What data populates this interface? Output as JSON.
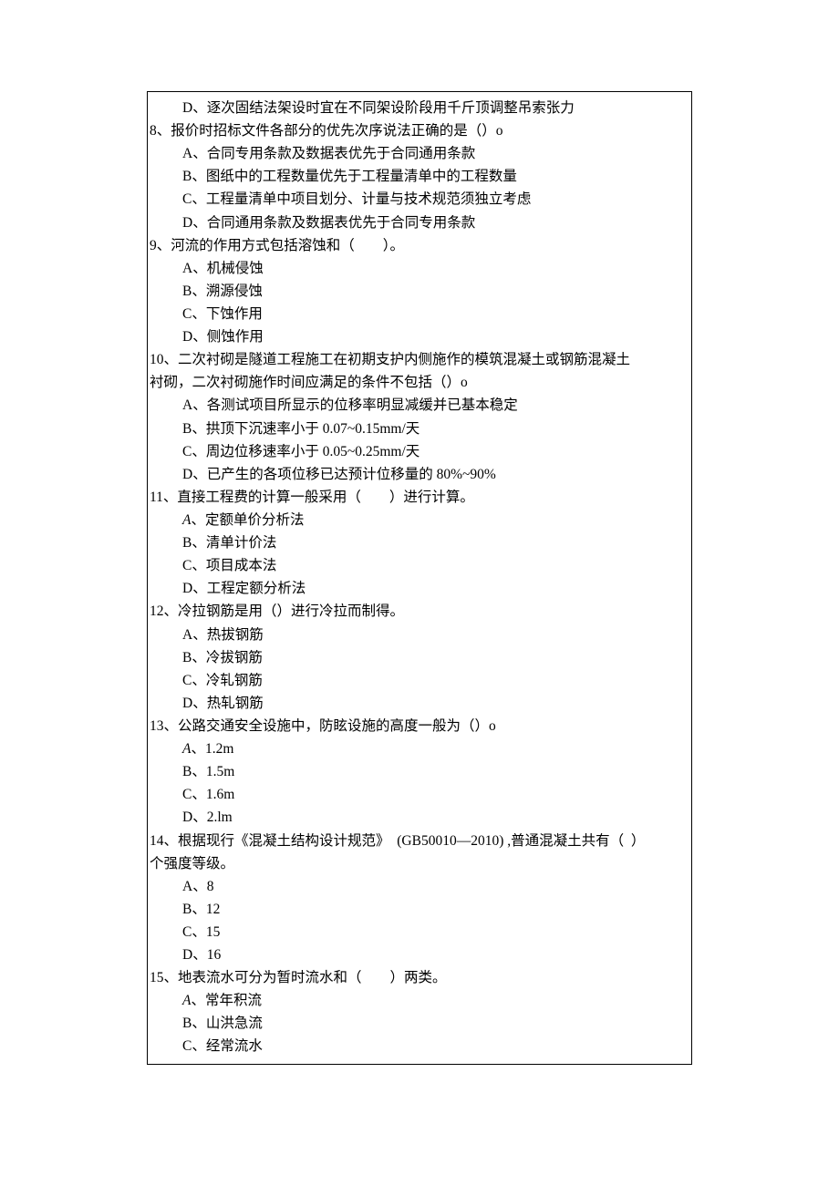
{
  "lines": [
    {
      "cls": "opt",
      "text": "D、逐次固结法架设时宜在不同架设阶段用千斤顶调整吊索张力"
    },
    {
      "cls": "stem",
      "text": "8、报价时招标文件各部分的优先次序说法正确的是（）o"
    },
    {
      "cls": "opt",
      "text": "A、合同专用条款及数据表优先于合同通用条款"
    },
    {
      "cls": "opt",
      "text": "B、图纸中的工程数量优先于工程量清单中的工程数量"
    },
    {
      "cls": "opt",
      "text": "C、工程量清单中项目划分、计量与技术规范须独立考虑"
    },
    {
      "cls": "opt",
      "text": "D、合同通用条款及数据表优先于合同专用条款"
    },
    {
      "cls": "stem",
      "text": "9、河流的作用方式包括溶蚀和（　　）。"
    },
    {
      "cls": "opt",
      "text": "A、机械侵蚀"
    },
    {
      "cls": "opt",
      "text": "B、溯源侵蚀"
    },
    {
      "cls": "opt",
      "text": "C、下蚀作用"
    },
    {
      "cls": "opt",
      "text": "D、侧蚀作用"
    },
    {
      "cls": "stem",
      "text": "10、二次衬砌是隧道工程施工在初期支护内侧施作的模筑混凝土或钢筋混凝土"
    },
    {
      "cls": "wrap",
      "text": "衬砌，二次衬砌施作时间应满足的条件不包括（）o"
    },
    {
      "cls": "opt",
      "text": "A、各测试项目所显示的位移率明显减缓并已基本稳定"
    },
    {
      "cls": "opt",
      "text": "B、拱顶下沉速率小于 0.07~0.15mm/天"
    },
    {
      "cls": "opt",
      "text": "C、周边位移速率小于 0.05~0.25mm/天"
    },
    {
      "cls": "opt",
      "text": "D、已产生的各项位移已达预计位移量的 80%~90%"
    },
    {
      "cls": "stem",
      "text": "11、直接工程费的计算一般采用（　　）进行计算。"
    },
    {
      "cls": "opt",
      "html": "<span class=\"ital\">A</span>、定额单价分析法"
    },
    {
      "cls": "opt",
      "text": "B、清单计价法"
    },
    {
      "cls": "opt",
      "text": "C、项目成本法"
    },
    {
      "cls": "opt",
      "text": "D、工程定额分析法"
    },
    {
      "cls": "stem",
      "text": "12、冷拉钢筋是用（）进行冷拉而制得。"
    },
    {
      "cls": "opt",
      "text": "A、热拔钢筋"
    },
    {
      "cls": "opt",
      "text": "B、冷拔钢筋"
    },
    {
      "cls": "opt",
      "text": "C、冷轧钢筋"
    },
    {
      "cls": "opt",
      "text": "D、热轧钢筋"
    },
    {
      "cls": "stem",
      "text": "13、公路交通安全设施中，防眩设施的高度一般为（）o"
    },
    {
      "cls": "opt",
      "html": "<span class=\"ital\">A</span>、1.2m"
    },
    {
      "cls": "opt",
      "text": "B、1.5m"
    },
    {
      "cls": "opt",
      "text": "C、1.6m"
    },
    {
      "cls": "opt",
      "text": "D、2.lm"
    },
    {
      "cls": "stem",
      "text": "14、根据现行《混凝土结构设计规范》  (GB50010—2010) ,普通混凝土共有（  ）"
    },
    {
      "cls": "wrap",
      "text": "个强度等级。"
    },
    {
      "cls": "opt",
      "text": "A、8"
    },
    {
      "cls": "opt",
      "text": "B、12"
    },
    {
      "cls": "opt",
      "text": "C、15"
    },
    {
      "cls": "opt",
      "text": "D、16"
    },
    {
      "cls": "stem",
      "text": "15、地表流水可分为暂时流水和（　　）两类。"
    },
    {
      "cls": "opt",
      "html": "<span class=\"ital\">A</span>、常年积流"
    },
    {
      "cls": "opt",
      "text": "B、山洪急流"
    },
    {
      "cls": "opt",
      "text": "C、经常流水"
    }
  ]
}
